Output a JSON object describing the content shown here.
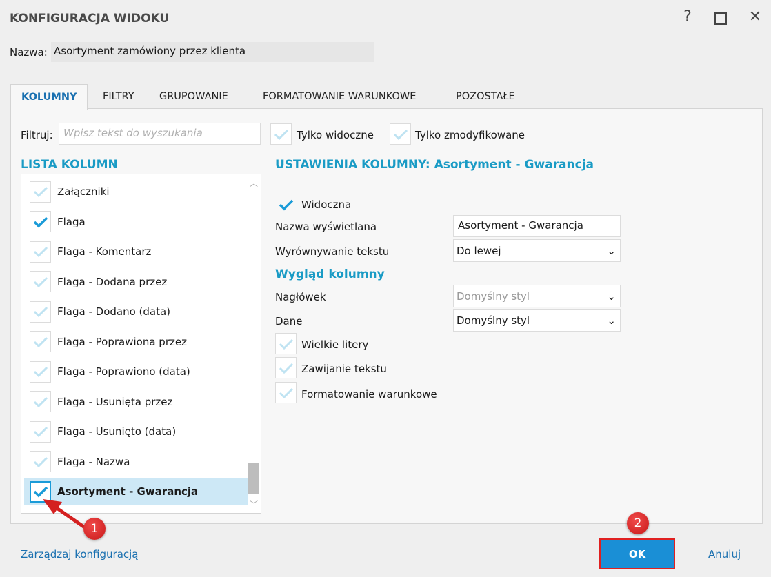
{
  "window": {
    "title": "KONFIGURACJA WIDOKU",
    "help": "?",
    "maximize": "☐",
    "close": "✕"
  },
  "name": {
    "label": "Nazwa:",
    "value": "Asortyment zamówiony przez klienta"
  },
  "tabs": [
    {
      "label": "KOLUMNY",
      "active": true
    },
    {
      "label": "FILTRY"
    },
    {
      "label": "GRUPOWANIE"
    },
    {
      "label": "FORMATOWANIE WARUNKOWE"
    },
    {
      "label": "POZOSTAŁE"
    }
  ],
  "filter": {
    "label": "Filtruj:",
    "placeholder": "Wpisz tekst do wyszukania",
    "only_visible": "Tylko widoczne",
    "only_modified": "Tylko zmodyfikowane"
  },
  "list": {
    "heading": "LISTA KOLUMN",
    "items": [
      {
        "label": "Załączniki",
        "checked": false
      },
      {
        "label": "Flaga",
        "checked": true
      },
      {
        "label": "Flaga - Komentarz",
        "checked": false
      },
      {
        "label": "Flaga - Dodana przez",
        "checked": false
      },
      {
        "label": "Flaga - Dodano (data)",
        "checked": false
      },
      {
        "label": "Flaga - Poprawiona przez",
        "checked": false
      },
      {
        "label": "Flaga - Poprawiono (data)",
        "checked": false
      },
      {
        "label": "Flaga - Usunięta przez",
        "checked": false
      },
      {
        "label": "Flaga - Usunięto (data)",
        "checked": false
      },
      {
        "label": "Flaga - Nazwa",
        "checked": false
      },
      {
        "label": "Asortyment - Gwarancja",
        "checked": true,
        "selected": true
      }
    ]
  },
  "settings": {
    "heading": "USTAWIENIA KOLUMNY: Asortyment - Gwarancja",
    "visible": "Widoczna",
    "display_name_label": "Nazwa wyświetlana",
    "display_name": "Asortyment - Gwarancja",
    "align_label": "Wyrównywanie tekstu",
    "align": "Do lewej",
    "look_heading": "Wygląd kolumny",
    "header_label": "Nagłówek",
    "header_style": "Domyślny styl",
    "data_label": "Dane",
    "data_style": "Domyślny styl",
    "uppercase": "Wielkie litery",
    "wrap": "Zawijanie tekstu",
    "cond_format": "Formatowanie warunkowe"
  },
  "footer": {
    "manage": "Zarządzaj konfiguracją",
    "ok": "OK",
    "cancel": "Anuluj"
  },
  "annotations": [
    "1",
    "2"
  ],
  "colors": {
    "accent": "#1a9bc5",
    "ok": "#1a8fd6",
    "annotation": "#d42020",
    "selected_row": "#cde8f6"
  }
}
